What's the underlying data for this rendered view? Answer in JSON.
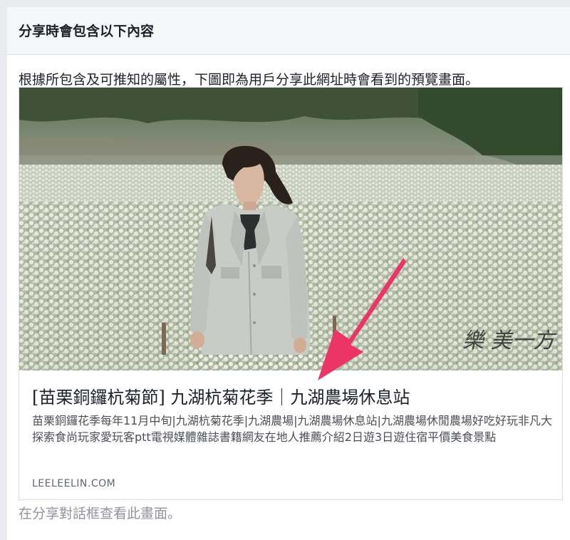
{
  "dialog": {
    "header_title": "分享時會包含以下內容",
    "intro_text": "根據所包含及可推知的屬性，下圖即為用戶分享此網址時會看到的預覽畫面。",
    "footer_note": "在分享對話框查看此畫面。"
  },
  "preview_card": {
    "image_alt": "white chrysanthemum field with woman in light jacket",
    "watermark": "樂  美一方",
    "title": "[苗栗銅鑼杭菊節] 九湖杭菊花季｜九湖農場休息站",
    "description": "苗栗銅鑼花季每年11月中旬|九湖杭菊花季|九湖農場|九湖農場休息站|九湖農場休閒農場好吃好玩非凡大探索食尚玩家愛玩客ptt電視媒體雜誌書籍網友在地人推薦介紹2日遊3日遊住宿平價美食景點",
    "domain": "LEELEELIN.COM"
  },
  "annotation": {
    "arrow_color": "#ec3566",
    "arrow_icon": "arrow-pointer-icon"
  }
}
